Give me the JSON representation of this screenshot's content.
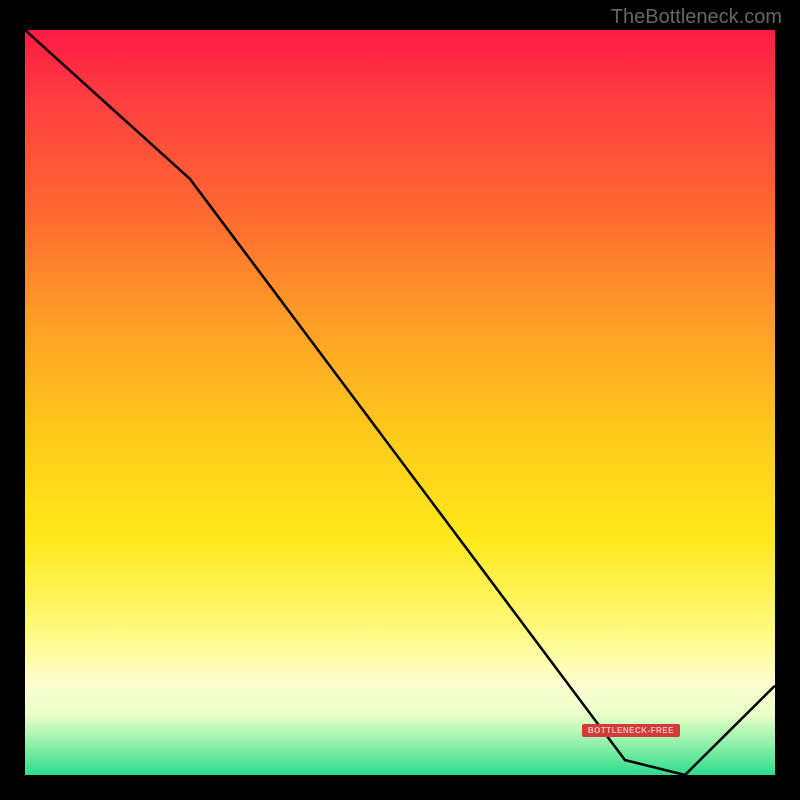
{
  "attribution": "TheBottleneck.com",
  "badge_label": "BOTTLENECK-FREE",
  "chart_data": {
    "type": "line",
    "title": "",
    "xlabel": "",
    "ylabel": "",
    "xlim": [
      0,
      100
    ],
    "ylim": [
      0,
      100
    ],
    "x": [
      0,
      22,
      80,
      88,
      100
    ],
    "values": [
      100,
      80,
      2,
      0,
      12
    ],
    "gradient_meaning": "red=high bottleneck, green=no bottleneck",
    "minimum_x": 88
  }
}
